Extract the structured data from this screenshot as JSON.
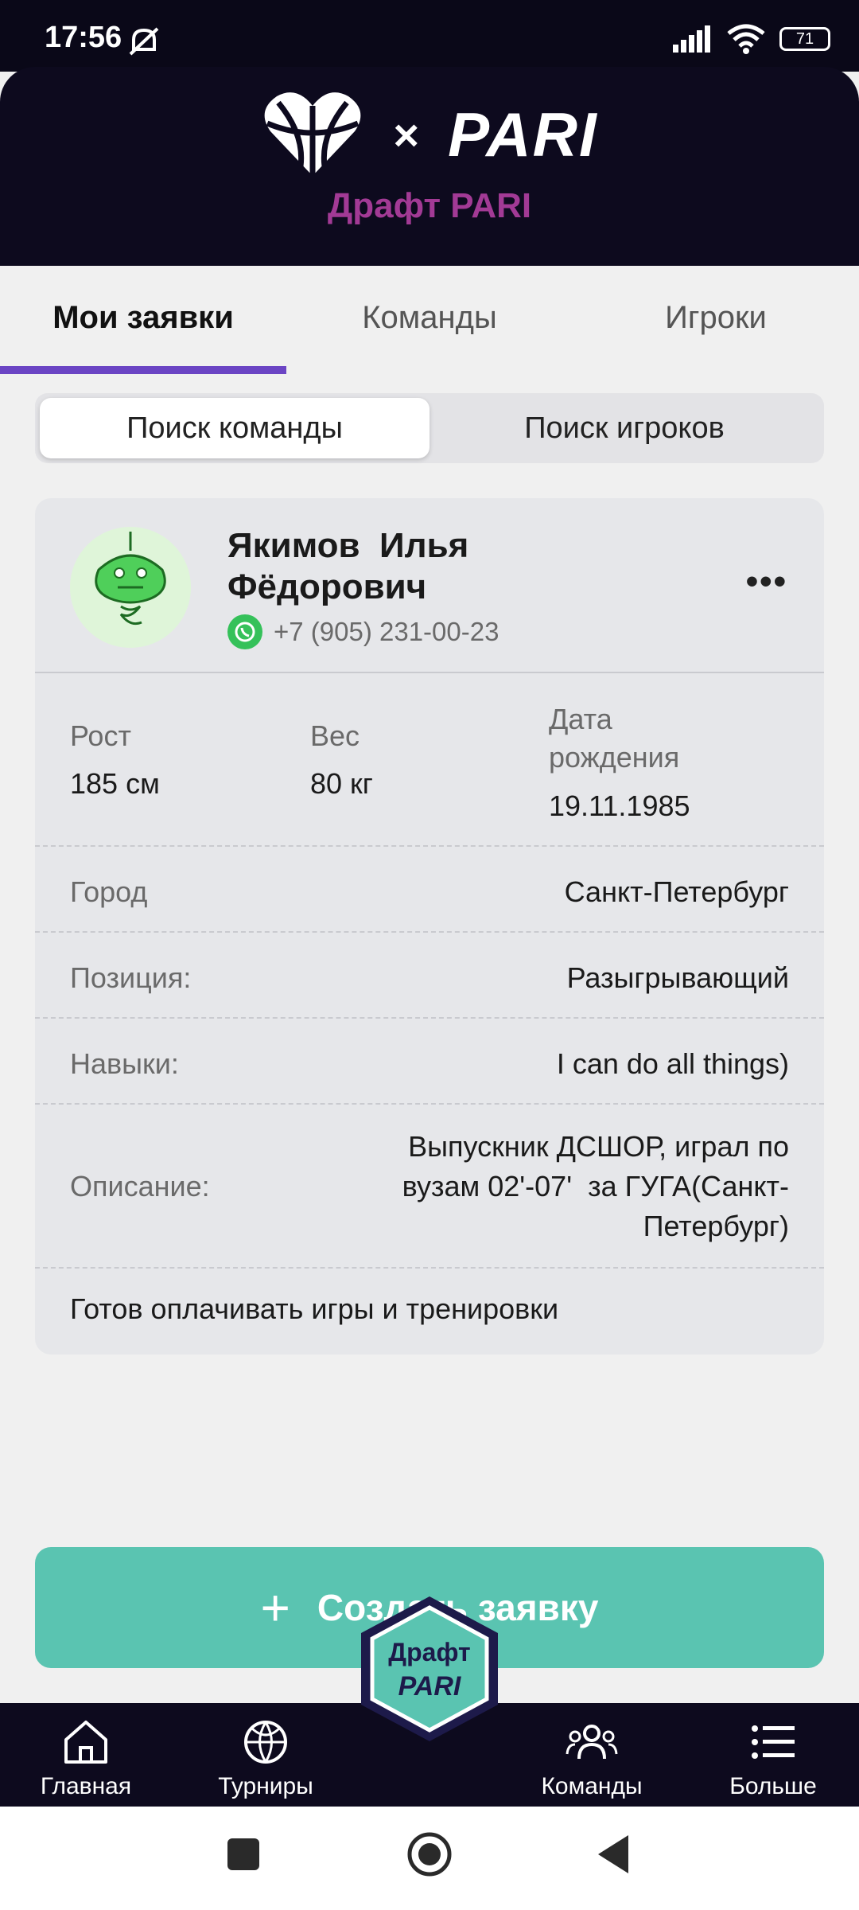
{
  "status_bar": {
    "time": "17:56",
    "battery": "71"
  },
  "header": {
    "x_sign": "×",
    "brand": "PARI",
    "subtitle": "Драфт PARI"
  },
  "tabs": [
    {
      "label": "Мои заявки",
      "active": true
    },
    {
      "label": "Команды",
      "active": false
    },
    {
      "label": "Игроки",
      "active": false
    }
  ],
  "segment": [
    {
      "label": "Поиск команды",
      "active": true
    },
    {
      "label": "Поиск игроков",
      "active": false
    }
  ],
  "card": {
    "name_line1": "Якимов  Илья",
    "name_line2": "Фёдорович",
    "phone": "+7 (905) 231-00-23",
    "more": "•••",
    "height_label": "Рост",
    "height_value": "185 см",
    "weight_label": "Вес",
    "weight_value": "80 кг",
    "dob_label_1": "Дата",
    "dob_label_2": "рождения",
    "dob_value": "19.11.1985",
    "city_label": "Город",
    "city_value": "Санкт-Петербург",
    "position_label": "Позиция:",
    "position_value": "Разыгрывающий",
    "skills_label": "Навыки:",
    "skills_value": "I can do all things)",
    "description_label": "Описание:",
    "description_line1": "Выпускник ДСШОР, играл по",
    "description_line2": "вузам 02'-07'  за ГУГА(Санкт-",
    "description_line3": "Петербург)",
    "note": "Готов оплачивать игры и тренировки"
  },
  "create_button": {
    "plus": "+",
    "label": "Создать заявку"
  },
  "fab": {
    "line1": "Драфт",
    "line2": "PARI"
  },
  "bottom_nav": [
    {
      "label": "Главная",
      "icon": "home-icon"
    },
    {
      "label": "Турниры",
      "icon": "basketball-icon"
    },
    {
      "label": "Команды",
      "icon": "people-icon"
    },
    {
      "label": "Больше",
      "icon": "menu-list-icon"
    }
  ],
  "colors": {
    "header_bg": "#0d0a1e",
    "subtitle": "#a23a95",
    "tab_indicator": "#6b45c4",
    "create_button": "#5ac4b1",
    "whatsapp": "#35c15a"
  }
}
